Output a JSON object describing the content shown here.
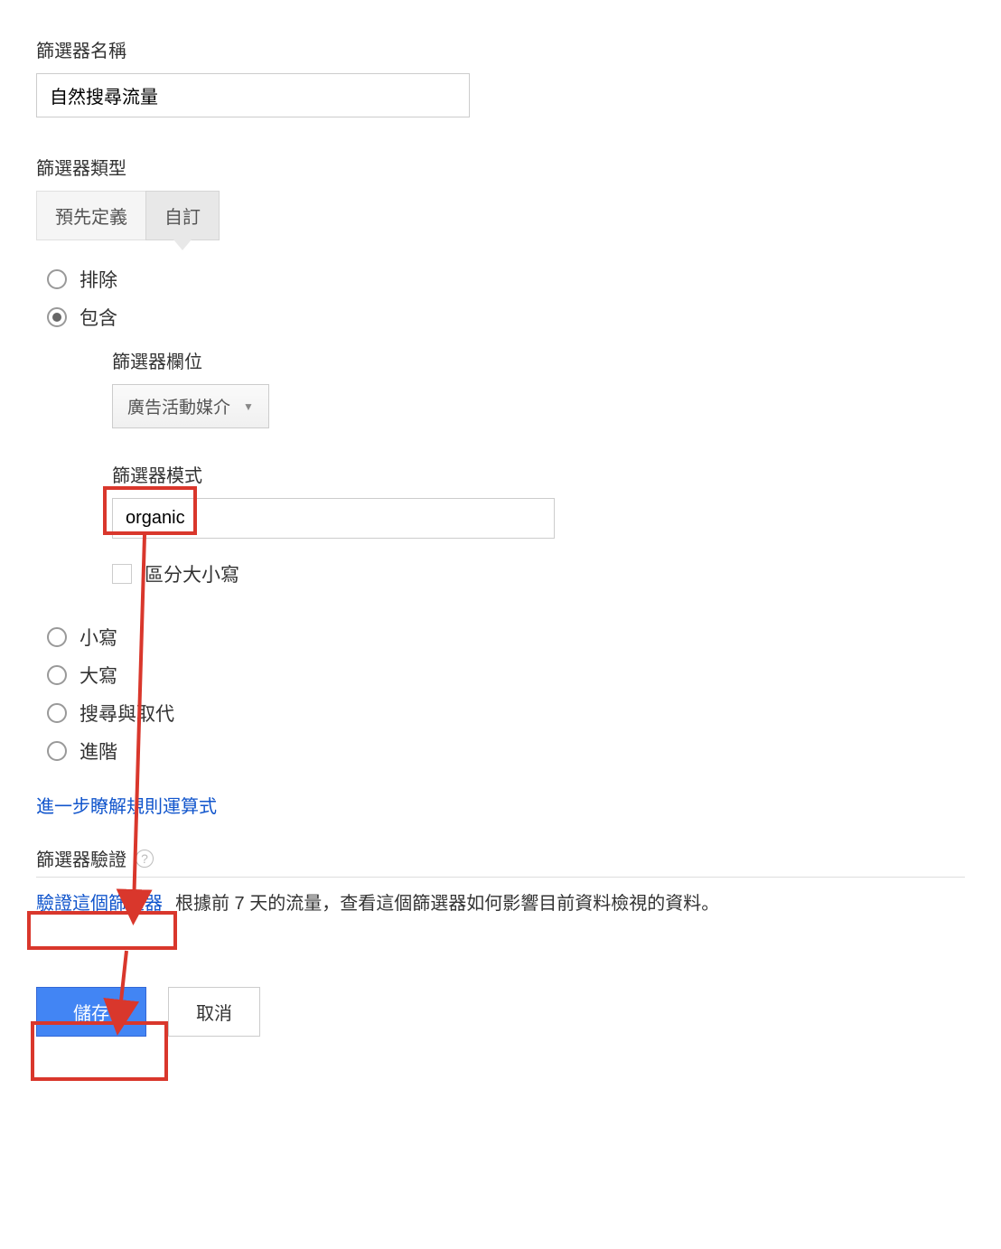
{
  "filterName": {
    "label": "篩選器名稱",
    "value": "自然搜尋流量"
  },
  "filterType": {
    "label": "篩選器類型",
    "tabs": {
      "predefined": "預先定義",
      "custom": "自訂"
    },
    "activeTab": "custom"
  },
  "actionRadios": {
    "exclude": "排除",
    "include": "包含"
  },
  "filterField": {
    "label": "篩選器欄位",
    "selected": "廣告活動媒介"
  },
  "filterPattern": {
    "label": "篩選器模式",
    "value": "organic"
  },
  "caseSensitive": {
    "label": "區分大小寫"
  },
  "caseRadios": {
    "lowercase": "小寫",
    "uppercase": "大寫",
    "searchReplace": "搜尋與取代",
    "advanced": "進階"
  },
  "learnMoreLink": "進一步瞭解規則運算式",
  "verify": {
    "header": "篩選器驗證",
    "link": "驗證這個篩選器",
    "description": "根據前 7 天的流量，查看這個篩選器如何影響目前資料檢視的資料。"
  },
  "buttons": {
    "save": "儲存",
    "cancel": "取消"
  }
}
